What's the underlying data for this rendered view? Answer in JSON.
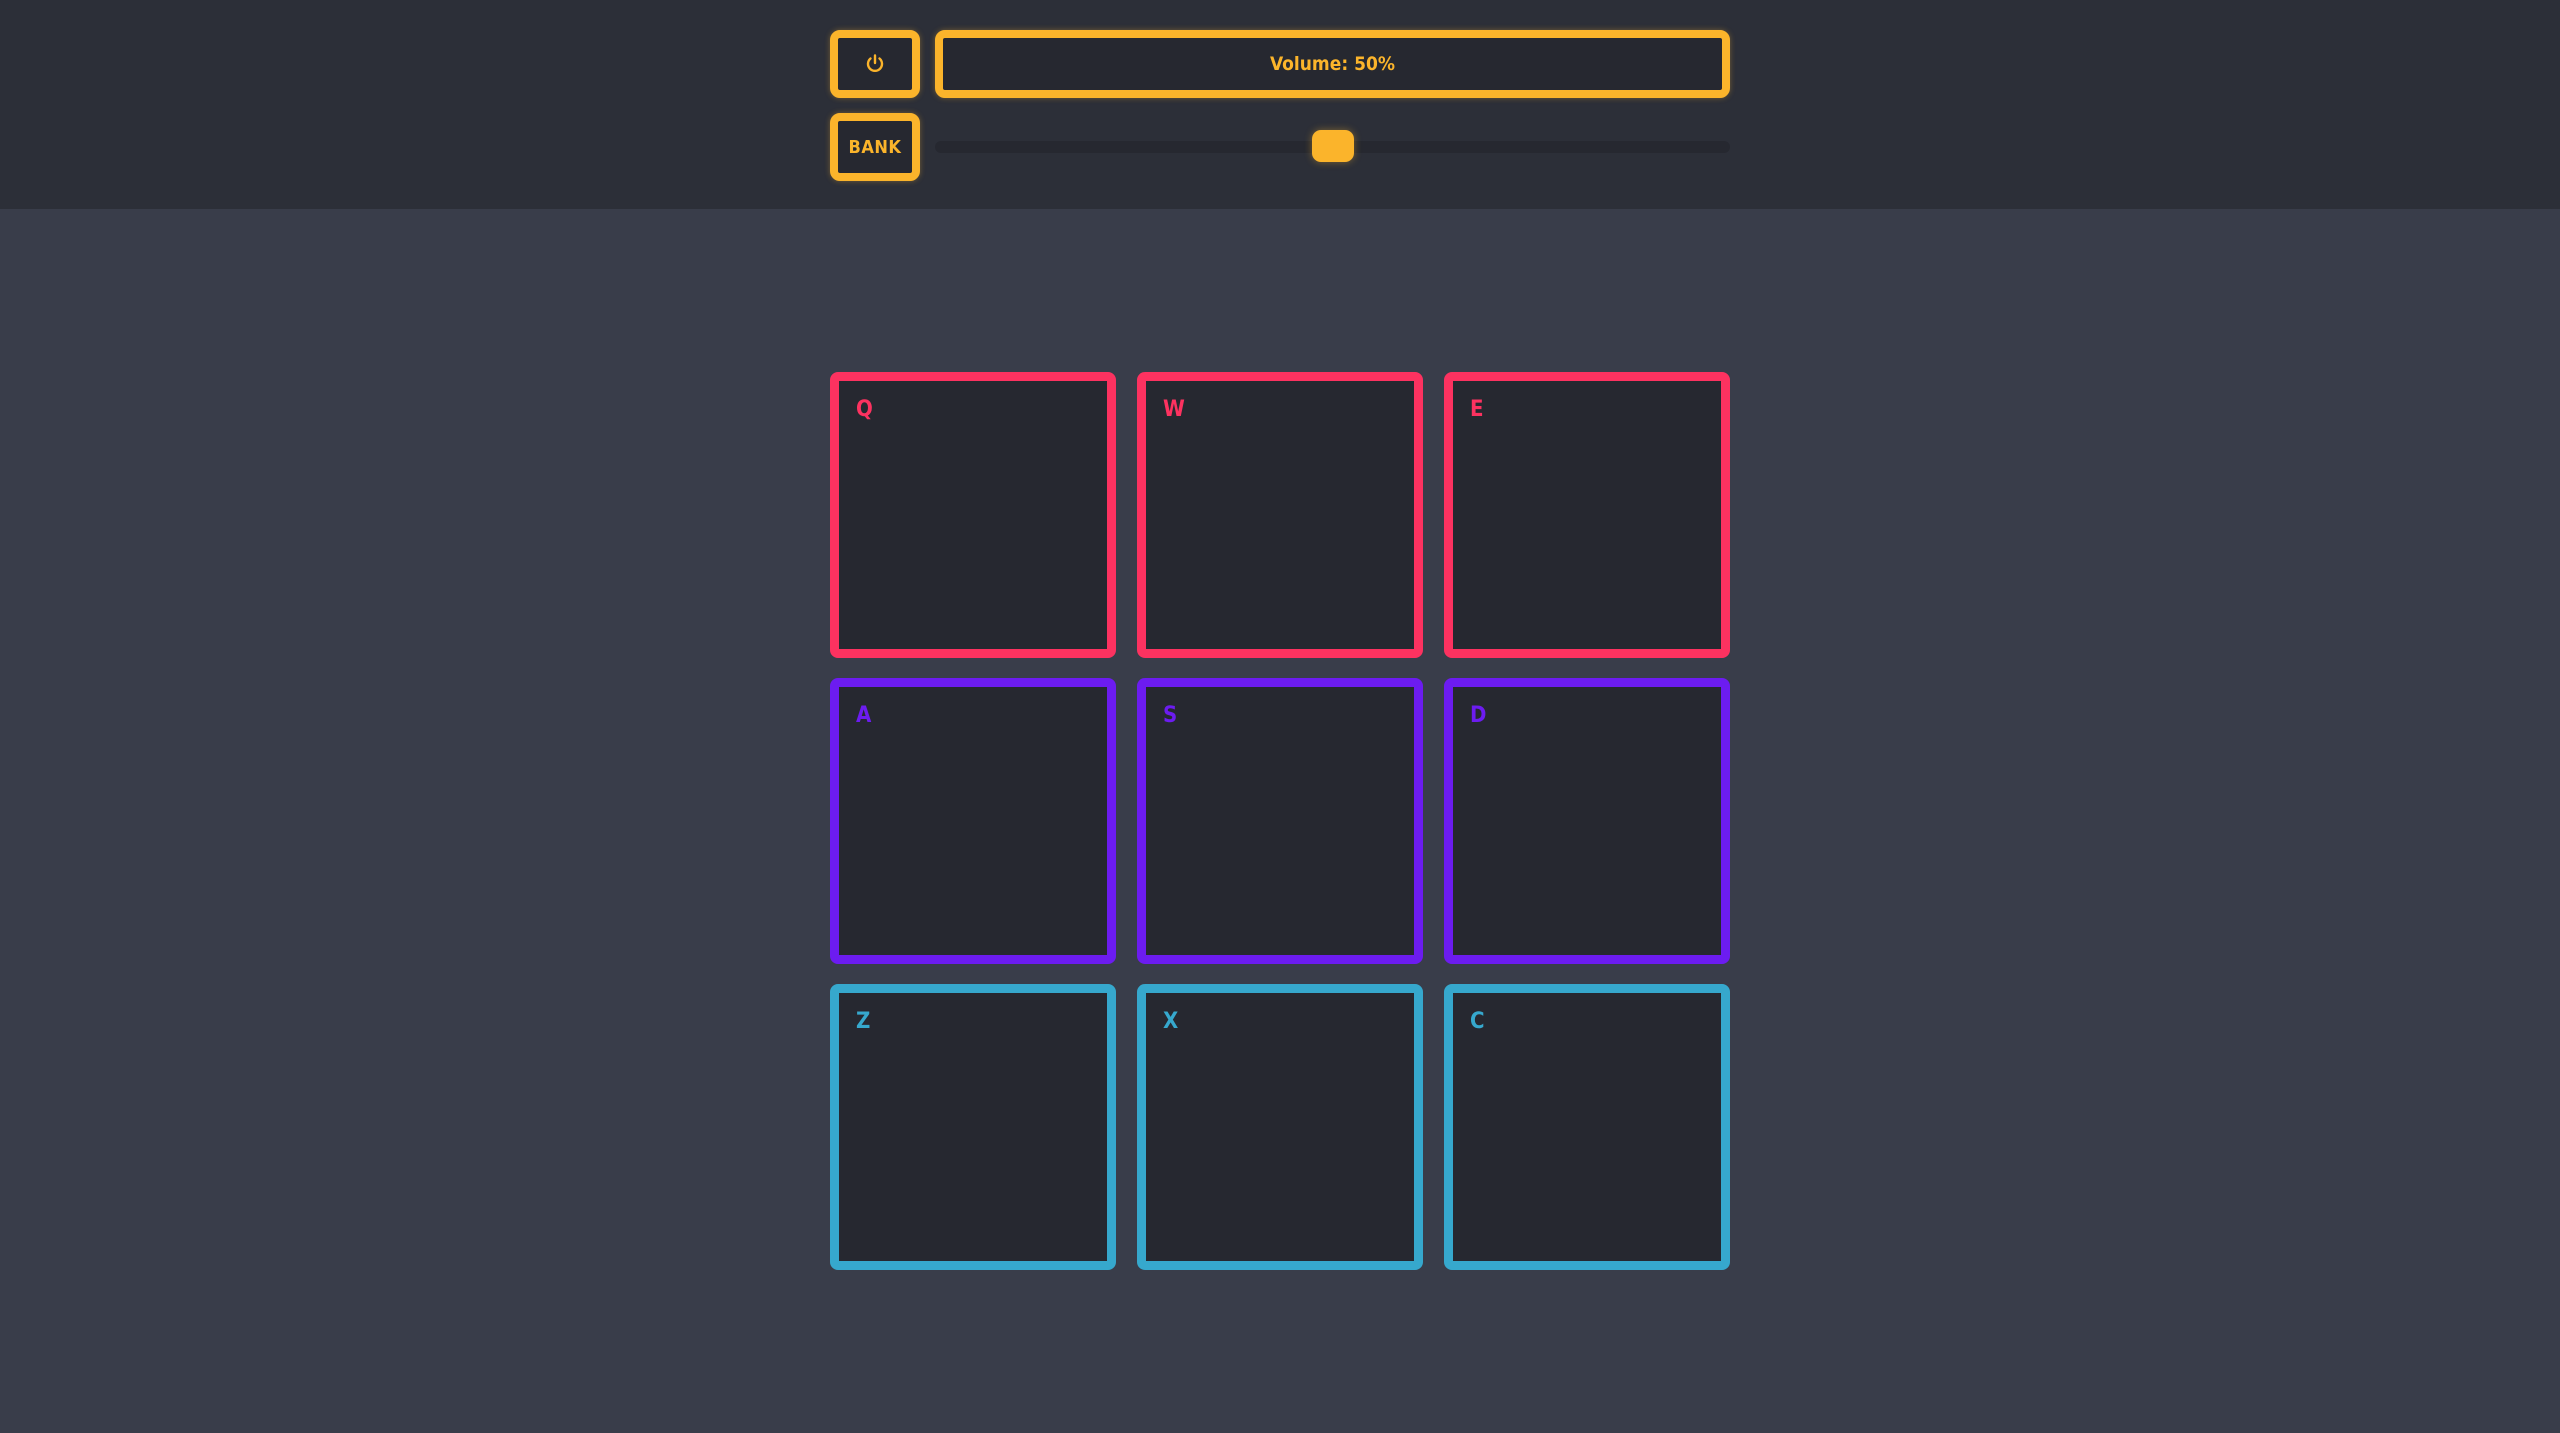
{
  "colors": {
    "accent": "#fbb42b",
    "row_colors": [
      "#fd3260",
      "#6c1cf0",
      "#36a8cd"
    ]
  },
  "controls": {
    "power_icon": "power-icon",
    "bank_label": "BANK",
    "display_text": "Volume: 50%",
    "volume_percent": 50
  },
  "pads": [
    {
      "key": "Q",
      "row": 0
    },
    {
      "key": "W",
      "row": 0
    },
    {
      "key": "E",
      "row": 0
    },
    {
      "key": "A",
      "row": 1
    },
    {
      "key": "S",
      "row": 1
    },
    {
      "key": "D",
      "row": 1
    },
    {
      "key": "Z",
      "row": 2
    },
    {
      "key": "X",
      "row": 2
    },
    {
      "key": "C",
      "row": 2
    }
  ]
}
